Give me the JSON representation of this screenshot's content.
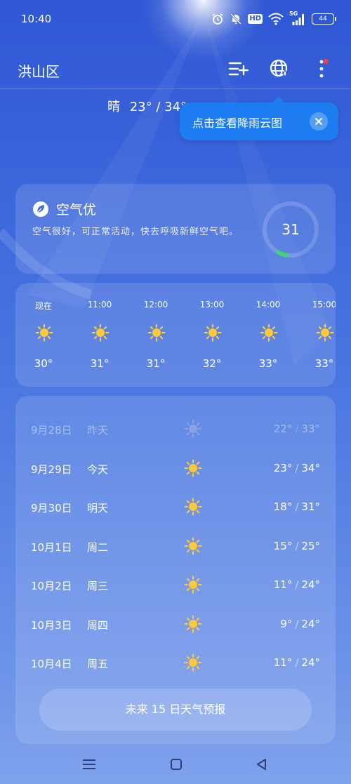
{
  "status_bar": {
    "time": "10:40",
    "icons": [
      "alarm-icon",
      "mute-icon",
      "hd-icon",
      "wifi-icon",
      "signal-5g-icon",
      "battery-icon"
    ],
    "hd_label": "HD",
    "network_label": "5G",
    "battery_level": "44"
  },
  "header": {
    "location": "洪山区",
    "icons": [
      "add-city-icon",
      "globe-rain-icon",
      "more-icon"
    ]
  },
  "summary": {
    "condition": "晴",
    "temp_range": "23° / 34°"
  },
  "tooltip": {
    "text": "点击查看降雨云图"
  },
  "air_quality": {
    "title": "空气优",
    "description": "空气很好，可正常活动，快去呼吸新鲜空气吧。",
    "aqi": "31",
    "aqi_fraction": 0.06,
    "ring_color": "#3fd37a"
  },
  "hourly": [
    {
      "time": "现在",
      "temp": "30°",
      "icon": "sunny-icon"
    },
    {
      "time": "11:00",
      "temp": "31°",
      "icon": "sunny-icon"
    },
    {
      "time": "12:00",
      "temp": "31°",
      "icon": "sunny-icon"
    },
    {
      "time": "13:00",
      "temp": "32°",
      "icon": "sunny-icon"
    },
    {
      "time": "14:00",
      "temp": "33°",
      "icon": "sunny-icon"
    },
    {
      "time": "15:00",
      "temp": "33°",
      "icon": "sunny-icon"
    }
  ],
  "daily": [
    {
      "date": "9月28日",
      "day": "昨天",
      "low": "22°",
      "high": "33°",
      "icon": "sunny-icon",
      "past": true
    },
    {
      "date": "9月29日",
      "day": "今天",
      "low": "23°",
      "high": "34°",
      "icon": "sunny-icon",
      "past": false
    },
    {
      "date": "9月30日",
      "day": "明天",
      "low": "18°",
      "high": "31°",
      "icon": "sunny-icon",
      "past": false
    },
    {
      "date": "10月1日",
      "day": "周二",
      "low": "15°",
      "high": "25°",
      "icon": "sunny-icon",
      "past": false
    },
    {
      "date": "10月2日",
      "day": "周三",
      "low": "11°",
      "high": "24°",
      "icon": "sunny-icon",
      "past": false
    },
    {
      "date": "10月3日",
      "day": "周四",
      "low": "9°",
      "high": "24°",
      "icon": "sunny-icon",
      "past": false
    },
    {
      "date": "10月4日",
      "day": "周五",
      "low": "11°",
      "high": "24°",
      "icon": "sunny-icon",
      "past": false
    }
  ],
  "forecast_button": "未来 15 日天气预报",
  "temp_separator": "/",
  "colors": {
    "background_top": "#2f57d4",
    "background_bottom": "#7fa2ec",
    "tooltip": "#1e7cf2",
    "sun": "#ffc93a",
    "notification_dot": "#ff3b3b"
  },
  "nav_bar": {
    "icons": [
      "menu-icon",
      "home-icon",
      "back-icon"
    ]
  }
}
